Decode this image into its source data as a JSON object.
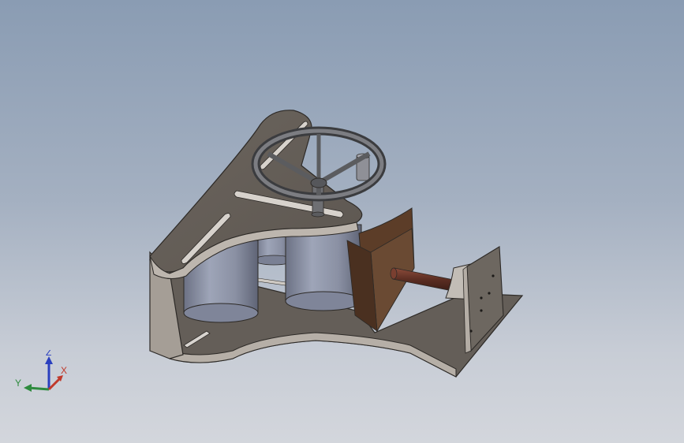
{
  "viewport": {
    "background_top": "#8a9cb3",
    "background_bottom": "#d3d6dc"
  },
  "model": {
    "parts": [
      "base-frame",
      "side-plate",
      "steering-wheel",
      "steering-column",
      "front-cylinder",
      "rear-cylinder",
      "bracket",
      "shaft",
      "mount-plate",
      "mount-gusset"
    ],
    "colors": {
      "sheet_metal": "#6f6861",
      "sheet_edge": "#b7b0a8",
      "cylinder": "#8c93a7",
      "wheel": "#5b5c5f",
      "shaft": "#5a2d22",
      "bracket": "#5c3d28"
    }
  },
  "triad": {
    "x_label": "X",
    "y_label": "Y",
    "z_label": "Z",
    "x_color": "#c0392b",
    "y_color": "#2e8b3e",
    "z_color": "#2a3fbf"
  }
}
